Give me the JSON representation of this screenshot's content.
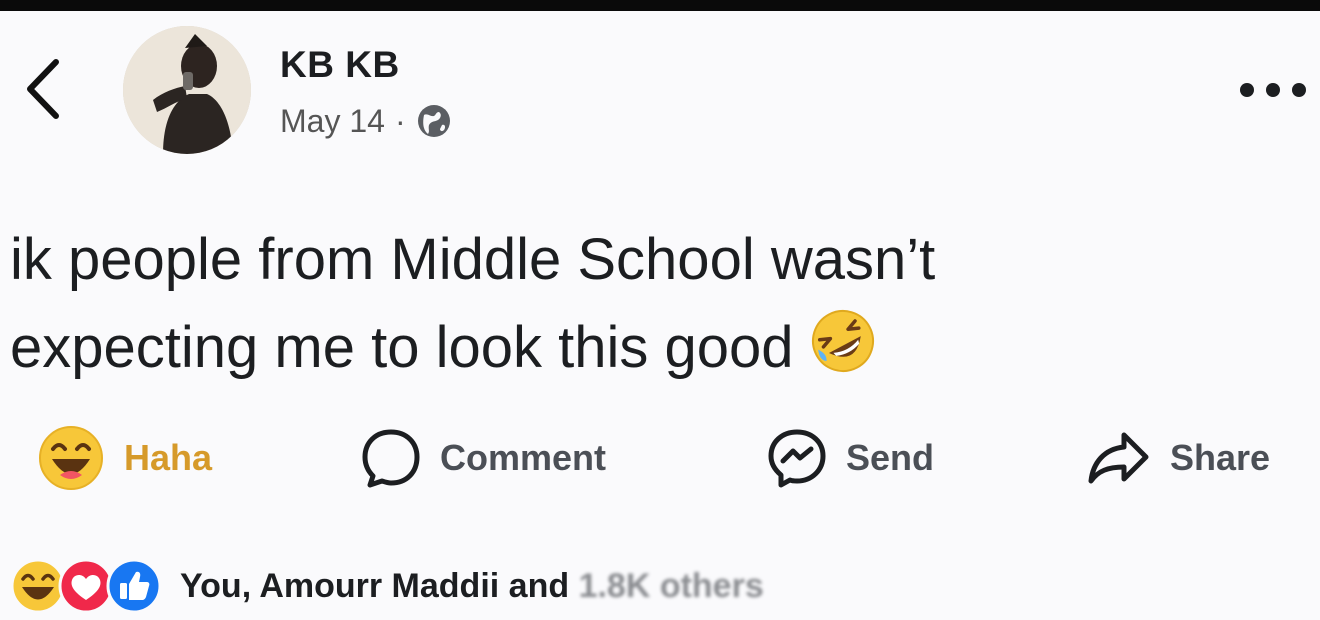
{
  "header": {
    "author": "KB KB",
    "date": "May 14",
    "separator": "·",
    "privacy_icon": "globe-icon",
    "back_icon": "chevron-left-icon",
    "more_icon": "more-horizontal-icon"
  },
  "post": {
    "line1": "ik people from Middle School wasn’t",
    "line2": "expecting me to look this good",
    "emoji": "rolling-on-floor-laughing-icon"
  },
  "actions": {
    "haha": "Haha",
    "comment": "Comment",
    "send": "Send",
    "share": "Share"
  },
  "reactions": {
    "icons": [
      "haha-icon",
      "love-icon",
      "like-icon"
    ],
    "summary": "You, Amourr Maddii and",
    "others_obscured": "1.8K others"
  },
  "colors": {
    "haha_accent": "#d69a2a",
    "love_red": "#f0284a",
    "like_blue": "#1877f2",
    "text": "#1c1e21"
  }
}
